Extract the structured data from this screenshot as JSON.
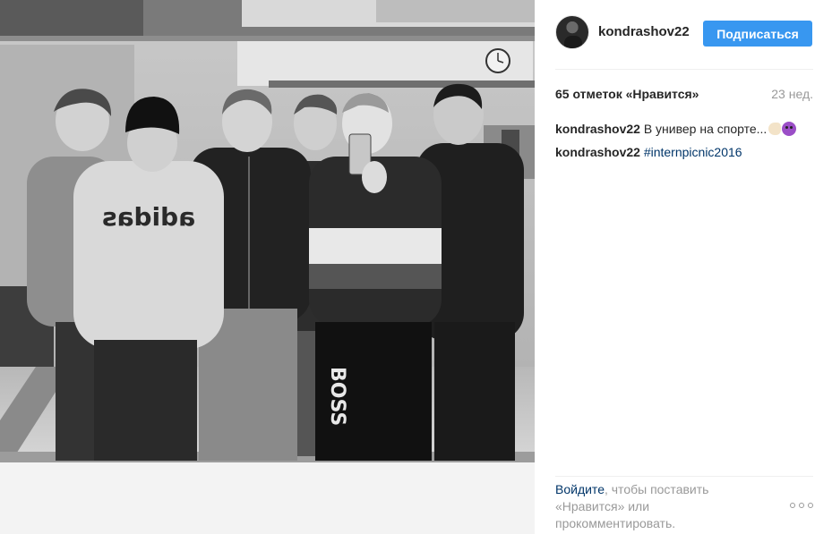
{
  "post": {
    "username": "kondrashov22",
    "follow_label": "Подписаться",
    "likes": "65 отметок «Нравится»",
    "age": "23 нед.",
    "comments": [
      {
        "user": "kondrashov22",
        "text": "В универ на спорте..."
      },
      {
        "user": "kondrashov22",
        "hashtag": "#internpicnic2016"
      }
    ],
    "login_prompt": {
      "link": "Войдите",
      "rest": ", чтобы поставить «Нравится» или прокомментировать."
    }
  },
  "photo": {
    "sweatshirt_text": "adidas",
    "pants_text": "BOSS"
  },
  "colors": {
    "follow_button": "#3897f0",
    "link": "#003569",
    "muted": "#999999"
  }
}
